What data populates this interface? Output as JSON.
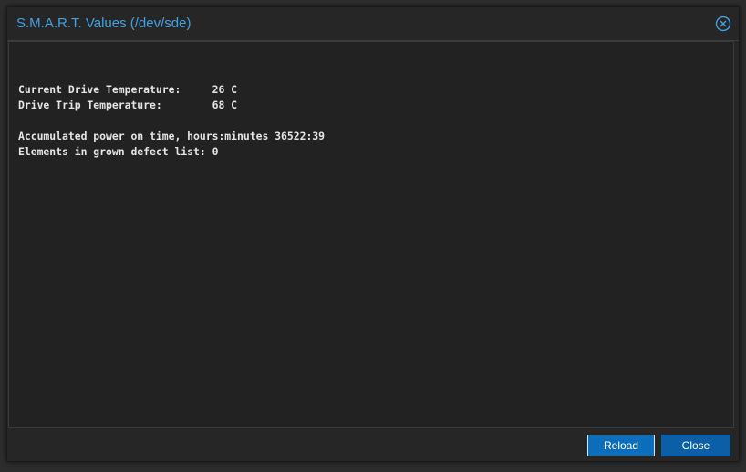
{
  "dialog": {
    "title": "S.M.A.R.T. Values (/dev/sde)",
    "accent_color": "#41a2e4",
    "close_icon": "circle-x-icon",
    "content": {
      "lines": [
        "",
        "Current Drive Temperature:     26 C",
        "Drive Trip Temperature:        68 C",
        "",
        "Accumulated power on time, hours:minutes 36522:39",
        "Elements in grown defect list: 0"
      ]
    },
    "buttons": {
      "reload_label": "Reload",
      "close_label": "Close"
    }
  }
}
